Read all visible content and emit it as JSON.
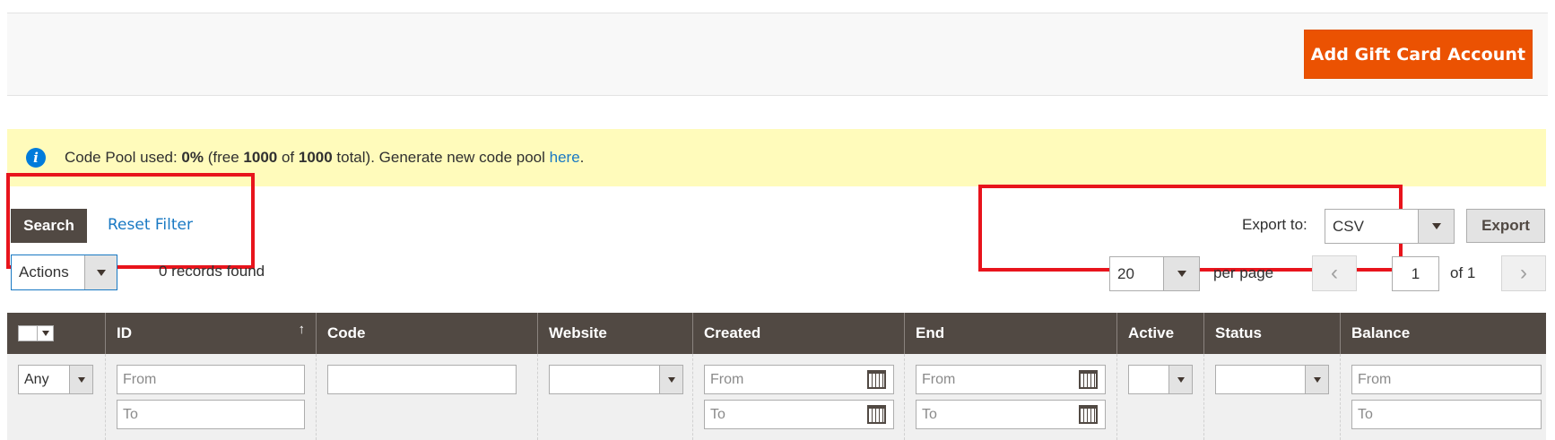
{
  "header": {
    "add_button_label": "Add Gift Card Account"
  },
  "notice": {
    "prefix": "Code Pool used: ",
    "percent": "0%",
    "mid1": " (free ",
    "free": "1000",
    "mid2": " of ",
    "total": "1000",
    "mid3": " total). Generate new code pool ",
    "link": "here",
    "suffix": "."
  },
  "toolbar": {
    "search_label": "Search",
    "reset_label": "Reset Filter",
    "actions_value": "Actions",
    "records_found": "0 records found",
    "export_label": "Export to:",
    "export_format": "CSV",
    "export_button": "Export",
    "per_page_value": "20",
    "per_page_label": "per page",
    "current_page": "1",
    "of_total": "of 1",
    "prev_glyph": "‹",
    "next_glyph": "›"
  },
  "columns": [
    {
      "label": ""
    },
    {
      "label": "ID",
      "sort": "↑"
    },
    {
      "label": "Code"
    },
    {
      "label": "Website"
    },
    {
      "label": "Created"
    },
    {
      "label": "End"
    },
    {
      "label": "Active"
    },
    {
      "label": "Status"
    },
    {
      "label": "Balance"
    }
  ],
  "filters": {
    "mass_select": "Any",
    "id_from": "From",
    "id_to": "To",
    "created_from": "From",
    "created_to": "To",
    "end_from": "From",
    "end_to": "To",
    "balance_from": "From",
    "balance_to": "To"
  },
  "colors": {
    "accent": "#eb5202",
    "link": "#1979c3",
    "header_bg": "#514943",
    "notice_bg": "#fffbbb",
    "highlight": "#e8141c"
  }
}
